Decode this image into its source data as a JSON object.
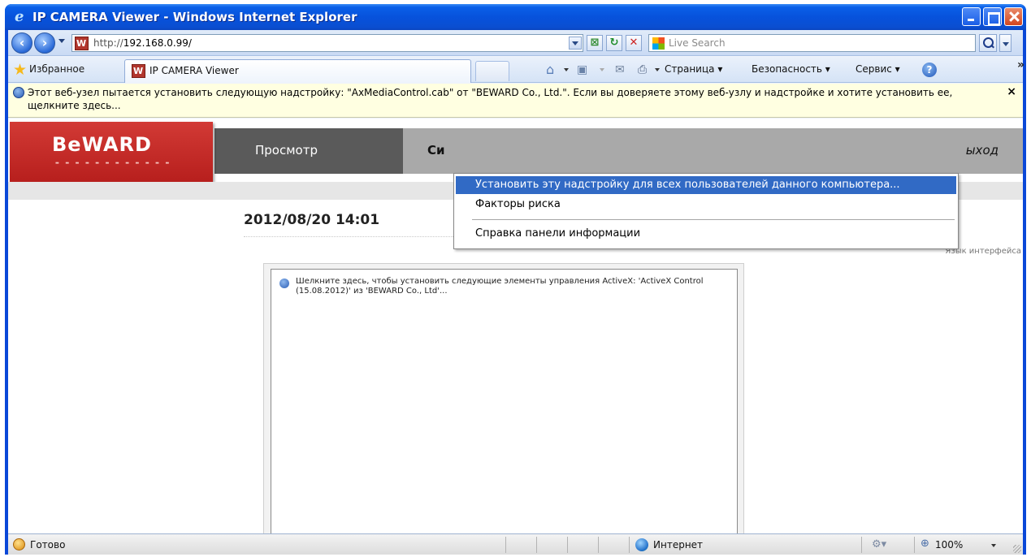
{
  "window": {
    "title": "IP CAMERA Viewer - Windows Internet Explorer",
    "accent": "#0a5fe8"
  },
  "addressbar": {
    "url_prefix": "http://",
    "url_host": "192.168.0.99/",
    "search_placeholder": "Live Search",
    "compat_icon": "compat-view-icon",
    "refresh_icon": "refresh-icon",
    "stop_icon": "stop-icon"
  },
  "commandbar": {
    "favorites_label": "Избранное",
    "tab_label": "IP CAMERA Viewer",
    "page_menu": "Страница ▾",
    "security_menu": "Безопасность ▾",
    "service_menu": "Сервис ▾",
    "help_glyph": "?",
    "more_glyph": "»"
  },
  "infobar": {
    "text": "Этот веб-узел пытается установить следующую надстройку: \"AxMediaControl.cab\" от \"BEWARD Co., Ltd.\". Если вы доверяете этому веб-узлу и надстройке и хотите установить ее, щелкните здесь...",
    "close_glyph": "×",
    "background": "#ffffe1"
  },
  "context_menu": {
    "items": [
      "Установить эту надстройку для всех пользователей данного компьютера...",
      "Факторы риска",
      "Справка панели информации"
    ],
    "highlight": "#316ac5"
  },
  "site": {
    "logo": "BeWARD",
    "logo_color": "#c8302c",
    "nav": {
      "view": "Просмотр",
      "system": "Си",
      "exit": "ыход"
    },
    "datetime": "2012/08/20 14:01",
    "language_label": "Язык интерфейса",
    "activex_notice": "Шелкните здесь, чтобы установить следующие элементы управления ActiveX: 'ActiveX Control (15.08.2012)' из 'BEWARD Co., Ltd'..."
  },
  "statusbar": {
    "status": "Готово",
    "zone": "Интернет",
    "zoom": "100%"
  }
}
